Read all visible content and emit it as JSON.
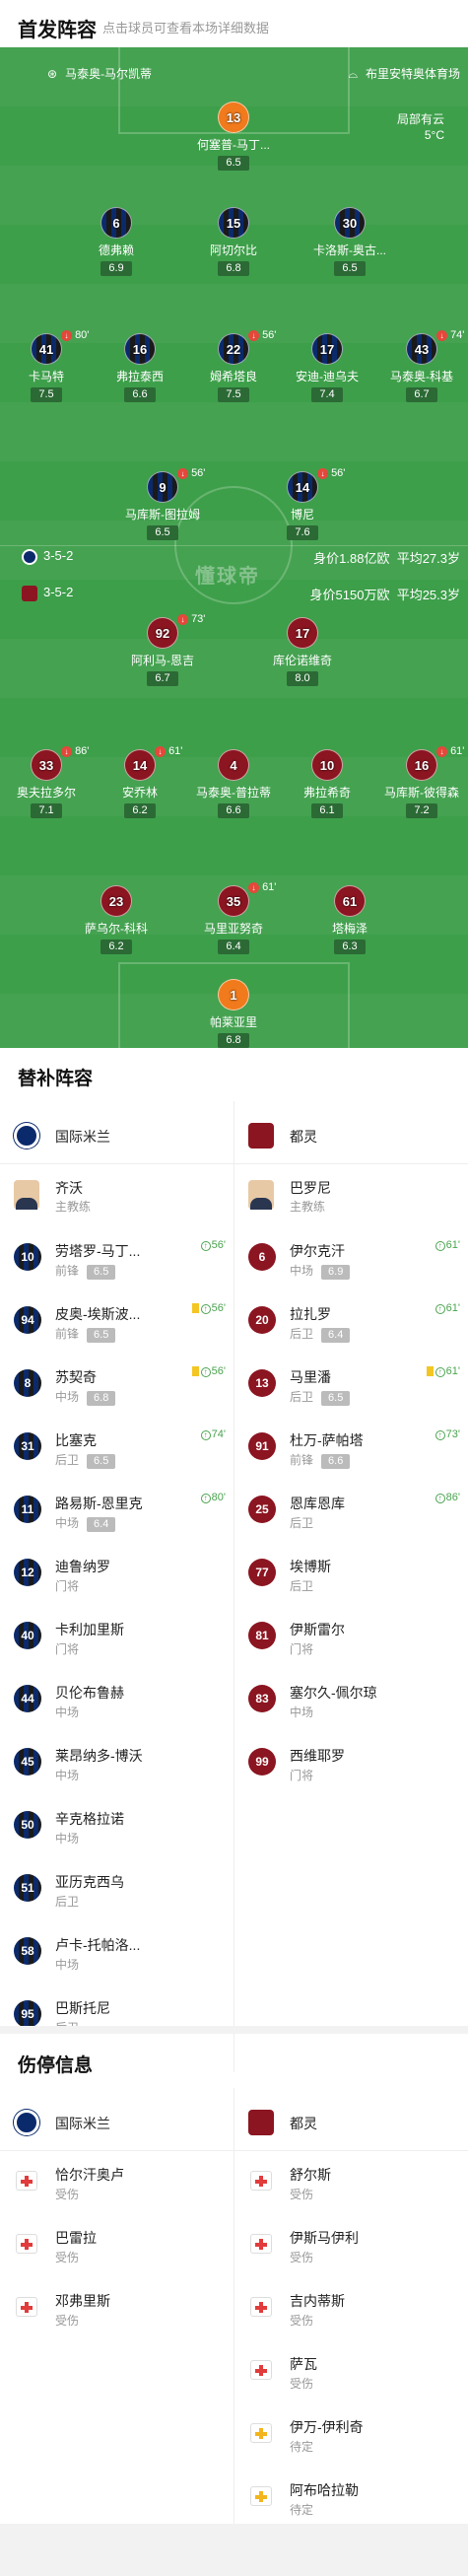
{
  "header": {
    "title": "首发阵容",
    "subtitle": "点击球员可查看本场详细数据"
  },
  "venue": {
    "referee": "马泰奥-马尔凯蒂",
    "stadium": "布里安特奥体育场",
    "weather": "局部有云",
    "temp": "5°C"
  },
  "inter": {
    "name": "国际米兰",
    "formation": "3-5-2",
    "value": "身价1.88亿欧",
    "age": "平均27.3岁"
  },
  "torino": {
    "name": "都灵",
    "formation": "3-5-2",
    "value": "身价5150万欧",
    "age": "平均25.3岁"
  },
  "watermark": "懂球帝",
  "players": [
    {
      "num": "13",
      "name": "何塞普-马丁...",
      "rating": "6.5",
      "team": "gk-torino"
    },
    {
      "num": "6",
      "name": "德弗赖",
      "rating": "6.9",
      "team": "inter"
    },
    {
      "num": "15",
      "name": "阿切尔比",
      "rating": "6.8",
      "team": "inter"
    },
    {
      "num": "30",
      "name": "卡洛斯-奥古...",
      "rating": "6.5",
      "team": "inter"
    },
    {
      "num": "41",
      "name": "卡马特",
      "rating": "7.5",
      "team": "inter",
      "evt": "80'"
    },
    {
      "num": "16",
      "name": "弗拉泰西",
      "rating": "6.6",
      "team": "inter"
    },
    {
      "num": "22",
      "name": "姆希塔良",
      "rating": "7.5",
      "team": "inter",
      "evt": "56'"
    },
    {
      "num": "17",
      "name": "安迪-迪乌夫",
      "rating": "7.4",
      "team": "inter"
    },
    {
      "num": "43",
      "name": "马泰奥-科基",
      "rating": "6.7",
      "team": "inter",
      "evt": "74'"
    },
    {
      "num": "9",
      "name": "马库斯-图拉姆",
      "rating": "6.5",
      "team": "inter",
      "evt": "56'"
    },
    {
      "num": "14",
      "name": "博尼",
      "rating": "7.6",
      "team": "inter",
      "evt": "56'"
    },
    {
      "num": "92",
      "name": "阿利马-恩吉",
      "rating": "6.7",
      "team": "torino",
      "evt": "73'"
    },
    {
      "num": "17",
      "name": "库伦诺维奇",
      "rating": "8.0",
      "team": "torino"
    },
    {
      "num": "33",
      "name": "奥夫拉多尔",
      "rating": "7.1",
      "team": "torino",
      "evt": "86'"
    },
    {
      "num": "14",
      "name": "安乔林",
      "rating": "6.2",
      "team": "torino",
      "evt": "61'"
    },
    {
      "num": "4",
      "name": "马泰奥-普拉蒂",
      "rating": "6.6",
      "team": "torino"
    },
    {
      "num": "10",
      "name": "弗拉希奇",
      "rating": "6.1",
      "team": "torino"
    },
    {
      "num": "16",
      "name": "马库斯-彼得森",
      "rating": "7.2",
      "team": "torino",
      "evt": "61'"
    },
    {
      "num": "23",
      "name": "萨乌尔-科科",
      "rating": "6.2",
      "team": "torino"
    },
    {
      "num": "35",
      "name": "马里亚努奇",
      "rating": "6.4",
      "team": "torino",
      "evt": "61'"
    },
    {
      "num": "61",
      "name": "塔梅泽",
      "rating": "6.3",
      "team": "torino"
    },
    {
      "num": "1",
      "name": "帕莱亚里",
      "rating": "6.8",
      "team": "gk-torino"
    }
  ],
  "subs_title": "替补阵容",
  "inter_coach": {
    "name": "齐沃",
    "role": "主教练"
  },
  "torino_coach": {
    "name": "巴罗尼",
    "role": "主教练"
  },
  "inter_subs": [
    {
      "num": "10",
      "name": "劳塔罗-马丁...",
      "pos": "前锋",
      "rating": "6.5",
      "min": "56'"
    },
    {
      "num": "94",
      "name": "皮奥-埃斯波...",
      "pos": "前锋",
      "rating": "6.5",
      "min": "56'",
      "card": true
    },
    {
      "num": "8",
      "name": "苏契奇",
      "pos": "中场",
      "rating": "6.8",
      "min": "56'",
      "card": true
    },
    {
      "num": "31",
      "name": "比塞克",
      "pos": "后卫",
      "rating": "6.5",
      "min": "74'"
    },
    {
      "num": "11",
      "name": "路易斯-恩里克",
      "pos": "中场",
      "rating": "6.4",
      "min": "80'"
    },
    {
      "num": "12",
      "name": "迪鲁纳罗",
      "pos": "门将"
    },
    {
      "num": "40",
      "name": "卡利加里斯",
      "pos": "门将"
    },
    {
      "num": "44",
      "name": "贝伦布鲁赫",
      "pos": "中场"
    },
    {
      "num": "45",
      "name": "莱昂纳多-博沃",
      "pos": "中场"
    },
    {
      "num": "50",
      "name": "辛克格拉诺",
      "pos": "中场"
    },
    {
      "num": "51",
      "name": "亚历克西乌",
      "pos": "后卫"
    },
    {
      "num": "58",
      "name": "卢卡-托帕洛...",
      "pos": "中场"
    },
    {
      "num": "95",
      "name": "巴斯托尼",
      "pos": "后卫"
    }
  ],
  "torino_subs": [
    {
      "num": "6",
      "name": "伊尔克汗",
      "pos": "中场",
      "rating": "6.9",
      "min": "61'"
    },
    {
      "num": "20",
      "name": "拉扎罗",
      "pos": "后卫",
      "rating": "6.4",
      "min": "61'"
    },
    {
      "num": "13",
      "name": "马里潘",
      "pos": "后卫",
      "rating": "6.5",
      "min": "61'",
      "card": true
    },
    {
      "num": "91",
      "name": "杜万-萨帕塔",
      "pos": "前锋",
      "rating": "6.6",
      "min": "73'"
    },
    {
      "num": "25",
      "name": "恩库恩库",
      "pos": "后卫",
      "min": "86'"
    },
    {
      "num": "77",
      "name": "埃博斯",
      "pos": "后卫"
    },
    {
      "num": "81",
      "name": "伊斯雷尔",
      "pos": "门将"
    },
    {
      "num": "83",
      "name": "塞尔久-佩尔琼",
      "pos": "中场"
    },
    {
      "num": "99",
      "name": "西维耶罗",
      "pos": "门将"
    }
  ],
  "injury_title": "伤停信息",
  "inter_injuries": [
    {
      "name": "恰尔汗奥卢",
      "type": "受伤",
      "doubt": false
    },
    {
      "name": "巴雷拉",
      "type": "受伤",
      "doubt": false
    },
    {
      "name": "邓弗里斯",
      "type": "受伤",
      "doubt": false
    }
  ],
  "torino_injuries": [
    {
      "name": "舒尔斯",
      "type": "受伤",
      "doubt": false
    },
    {
      "name": "伊斯马伊利",
      "type": "受伤",
      "doubt": false
    },
    {
      "name": "吉内蒂斯",
      "type": "受伤",
      "doubt": false
    },
    {
      "name": "萨瓦",
      "type": "受伤",
      "doubt": false
    },
    {
      "name": "伊万-伊利奇",
      "type": "待定",
      "doubt": true
    },
    {
      "name": "阿布哈拉勒",
      "type": "待定",
      "doubt": true
    }
  ],
  "colors": {
    "pitch": "#3e9f4a",
    "inter": "#0b2a6b",
    "torino": "#8b1520",
    "keeper": "#f07a1c"
  }
}
